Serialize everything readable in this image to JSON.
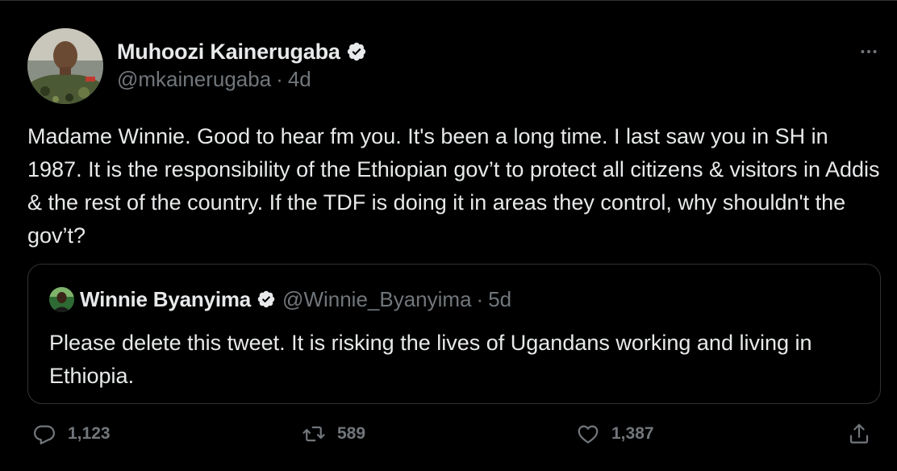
{
  "author": {
    "name": "Muhoozi Kainerugaba",
    "handle": "@mkainerugaba",
    "separator": "·",
    "time": "4d",
    "verified": true
  },
  "tweet": {
    "text": "Madame Winnie. Good to hear fm you. It's been a long time. I last saw you in SH in 1987. It is the responsibility of the Ethiopian gov’t to protect all citizens & visitors in Addis & the rest of the country. If the TDF is doing it in areas they control, why shouldn't the gov’t?"
  },
  "quote": {
    "name": "Winnie Byanyima",
    "handle": "@Winnie_Byanyima",
    "separator": "·",
    "time": "5d",
    "verified": true,
    "text": "Please delete this tweet. It is risking the lives of Ugandans working and living in Ethiopia."
  },
  "actions": {
    "replies": "1,123",
    "retweets": "589",
    "likes": "1,387"
  },
  "icons": {
    "more": "more-horizontal-icon",
    "reply": "reply-icon",
    "retweet": "retweet-icon",
    "like": "heart-icon",
    "share": "share-icon",
    "verified": "verified-badge-icon"
  },
  "colors": {
    "background": "#000000",
    "text": "#e7e9ea",
    "muted": "#71767b",
    "border": "#2f3336"
  }
}
